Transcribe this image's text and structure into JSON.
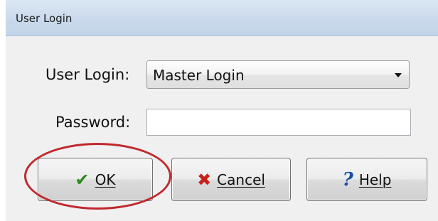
{
  "window": {
    "title": "User Login"
  },
  "form": {
    "user_login_label": "User Login:",
    "user_login_value": "Master Login",
    "password_label": "Password:",
    "password_value": ""
  },
  "buttons": {
    "ok_label": "OK",
    "cancel_label": "Cancel",
    "help_label": "Help"
  },
  "icons": {
    "ok": "checkmark-icon",
    "cancel": "x-icon",
    "help": "question-mark-icon",
    "dropdown": "dropdown-arrow-icon"
  },
  "colors": {
    "highlight": "#c0282d",
    "check": "#2f8a1e",
    "cancel_x": "#c8211b",
    "help_q": "#1a4fa8",
    "titlebar": "#c9d9ec"
  }
}
